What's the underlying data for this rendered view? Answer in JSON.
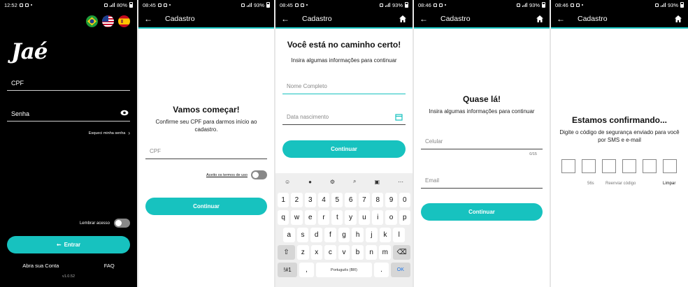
{
  "colors": {
    "accent": "#17c2bf",
    "dark_bg": "#000000"
  },
  "login": {
    "status_time": "12:52",
    "status_battery": "80%",
    "logo": "Jaé",
    "flags": [
      "flag-brazil",
      "flag-usa",
      "flag-spain"
    ],
    "cpf_label": "CPF",
    "password_label": "Senha",
    "forgot_label": "Esqueci minha senha",
    "remember_label": "Lembrar acesso",
    "enter_label": "Entrar",
    "open_account": "Abra sua Conta",
    "faq": "FAQ",
    "version": "v1.0.52"
  },
  "step1": {
    "status_time": "08:45",
    "status_battery": "93%",
    "title": "Cadastro",
    "heading": "Vamos começar!",
    "subtitle": "Confirme seu CPF para darmos início ao cadastro.",
    "cpf_placeholder": "CPF",
    "terms_label": "Aceito os termos de uso",
    "continue_label": "Continuar"
  },
  "step2": {
    "status_time": "08:45",
    "status_battery": "93%",
    "title": "Cadastro",
    "heading": "Você está no caminho certo!",
    "subtitle": "Insira algumas informações para continuar",
    "name_placeholder": "Nome Completo",
    "birth_placeholder": "Data nascimento",
    "continue_label": "Continuar",
    "keyboard": {
      "numbers": [
        "1",
        "2",
        "3",
        "4",
        "5",
        "6",
        "7",
        "8",
        "9",
        "0"
      ],
      "row1": [
        "q",
        "w",
        "e",
        "r",
        "t",
        "y",
        "u",
        "i",
        "o",
        "p"
      ],
      "row2": [
        "a",
        "s",
        "d",
        "f",
        "g",
        "h",
        "j",
        "k",
        "l"
      ],
      "row3": [
        "z",
        "x",
        "c",
        "v",
        "b",
        "n",
        "m"
      ],
      "symbols": "!#1",
      "comma": ",",
      "space": "Português (BR)",
      "period": ".",
      "ok": "OK"
    }
  },
  "step3": {
    "status_time": "08:46",
    "status_battery": "93%",
    "title": "Cadastro",
    "heading": "Quase lá!",
    "subtitle": "Insira algumas informações para continuar",
    "phone_placeholder": "Celular",
    "phone_counter": "0/15",
    "email_placeholder": "Email",
    "continue_label": "Continuar"
  },
  "step4": {
    "status_time": "08:46",
    "status_battery": "93%",
    "title": "Cadastro",
    "heading": "Estamos confirmando...",
    "subtitle": "Digite o código de segurança enviado para você por SMS e e-mail",
    "timer": "56s",
    "resend": "Reenviar código",
    "clear": "Limpar"
  }
}
